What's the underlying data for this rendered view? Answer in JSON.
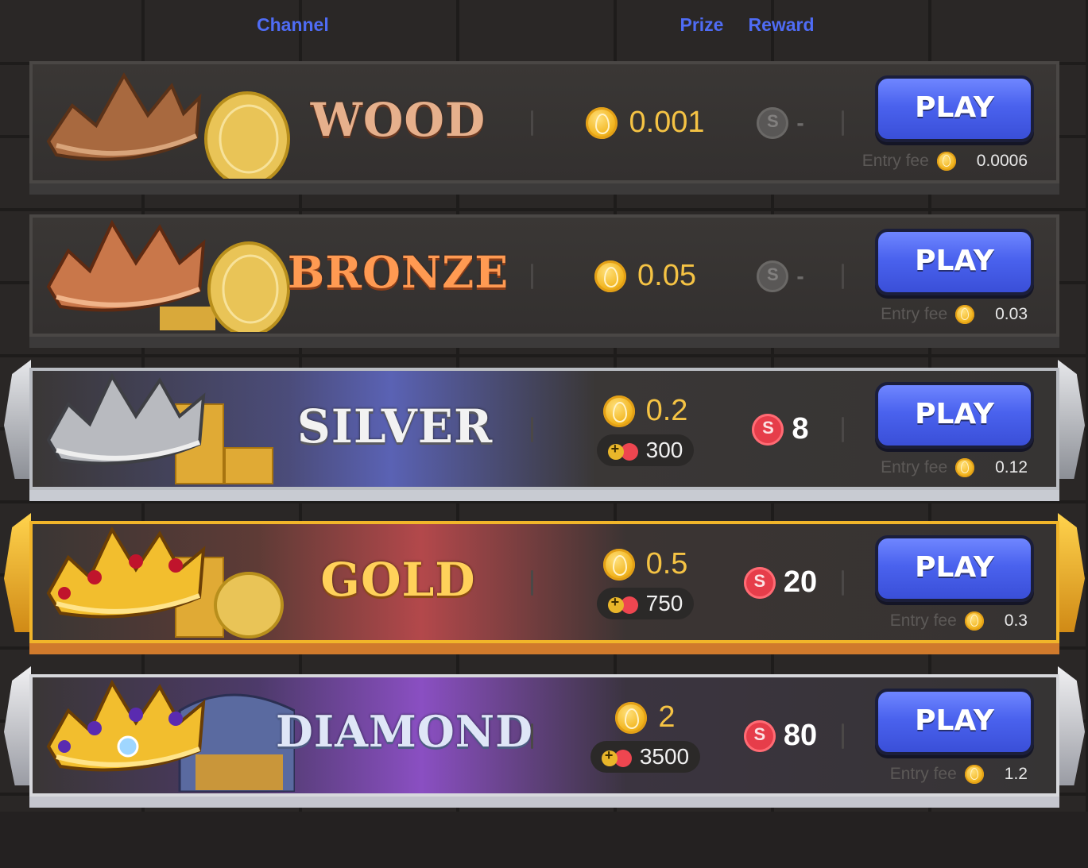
{
  "header": {
    "channel": "Channel",
    "prize": "Prize",
    "reward": "Reward"
  },
  "play_label": "PLAY",
  "entry_fee_label": "Entry fee",
  "colors": {
    "play_button": "#4a62ee",
    "header_text": "#4f6cf5",
    "prize_text": "#f5c344",
    "reward_icon": "#e63d4a",
    "gold_border": "#f1b52a"
  },
  "channels": [
    {
      "id": "wood",
      "name": "WOOD",
      "prize": "0.001",
      "bonus": "",
      "reward": "-",
      "reward_active": false,
      "entry_fee": "0.0006"
    },
    {
      "id": "bronze",
      "name": "BRONZE",
      "prize": "0.05",
      "bonus": "",
      "reward": "-",
      "reward_active": false,
      "entry_fee": "0.03"
    },
    {
      "id": "silver",
      "name": "SILVER",
      "prize": "0.2",
      "bonus": "300",
      "reward": "8",
      "reward_active": true,
      "entry_fee": "0.12"
    },
    {
      "id": "gold",
      "name": "GOLD",
      "prize": "0.5",
      "bonus": "750",
      "reward": "20",
      "reward_active": true,
      "entry_fee": "0.3"
    },
    {
      "id": "diamond",
      "name": "DIAMOND",
      "prize": "2",
      "bonus": "3500",
      "reward": "80",
      "reward_active": true,
      "entry_fee": "1.2"
    }
  ]
}
